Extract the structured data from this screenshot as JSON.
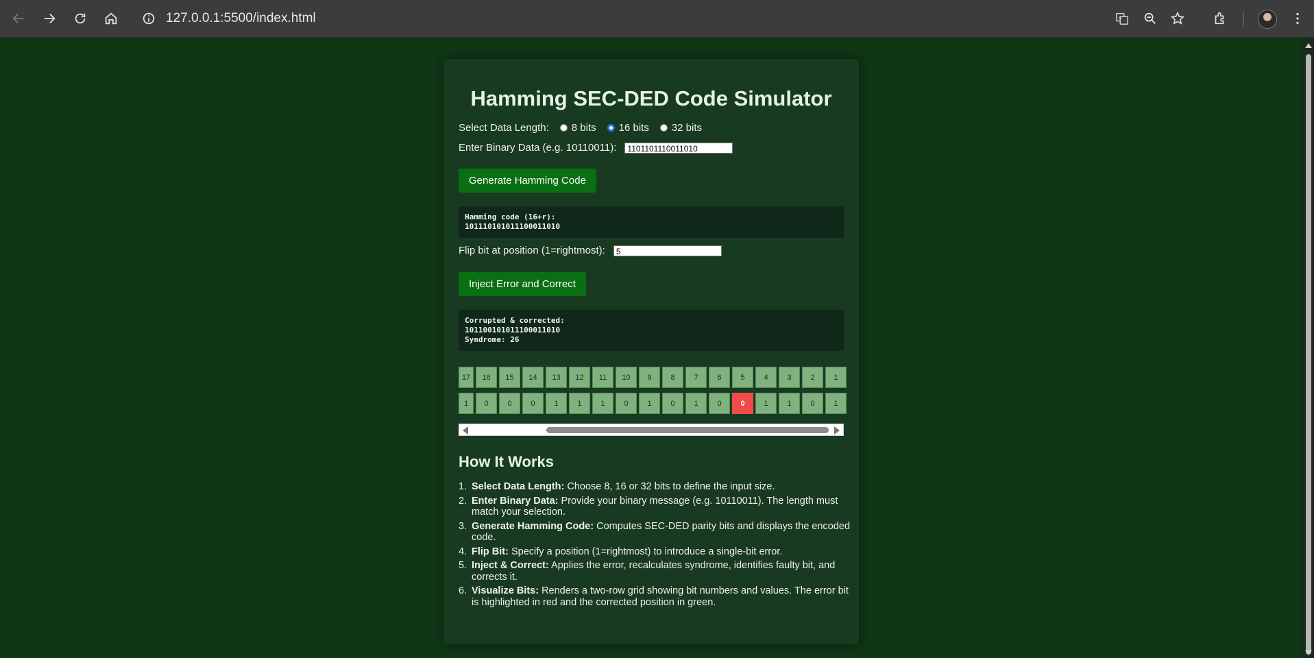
{
  "browser": {
    "url": "127.0.0.1:5500/index.html"
  },
  "page": {
    "title": "Hamming SEC-DED Code Simulator",
    "data_length": {
      "label": "Select Data Length:",
      "options": [
        "8 bits",
        "16 bits",
        "32 bits"
      ],
      "selected": "16 bits"
    },
    "binary_input": {
      "label": "Enter Binary Data (e.g. 10110011):",
      "value": "1101101110011010"
    },
    "generate_button": "Generate Hamming Code",
    "hamming_output": {
      "line1": "Hamming code (16+r):",
      "line2": "10111010101110001101​0"
    },
    "flip_input": {
      "label": "Flip bit at position (1=rightmost):",
      "value": "5"
    },
    "inject_button": "Inject Error and Correct",
    "corrected_output": {
      "line1": "Corrupted & corrected:",
      "line2": "10110010101110001101​0",
      "line3": "Syndrome: 26"
    },
    "bit_grid": {
      "positions": [
        "17",
        "16",
        "15",
        "14",
        "13",
        "12",
        "11",
        "10",
        "9",
        "8",
        "7",
        "6",
        "5",
        "4",
        "3",
        "2",
        "1"
      ],
      "values": [
        "1",
        "0",
        "0",
        "0",
        "1",
        "1",
        "1",
        "0",
        "1",
        "0",
        "1",
        "0",
        "0",
        "1",
        "1",
        "0",
        "1"
      ],
      "error_position": "5",
      "error_color": "#f24a4a",
      "cell_color": "#7fb27f"
    },
    "how_it_works": {
      "heading": "How It Works",
      "steps": [
        {
          "num": "1.",
          "title": "Select Data Length:",
          "text": " Choose 8, 16 or 32 bits to define the input size."
        },
        {
          "num": "2.",
          "title": "Enter Binary Data:",
          "text": " Provide your binary message (e.g. 10110011). The length must match your selection."
        },
        {
          "num": "3.",
          "title": "Generate Hamming Code:",
          "text": " Computes SEC-DED parity bits and displays the encoded code."
        },
        {
          "num": "4.",
          "title": "Flip Bit:",
          "text": " Specify a position (1=rightmost) to introduce a single-bit error."
        },
        {
          "num": "5.",
          "title": "Inject & Correct:",
          "text": " Applies the error, recalculates syndrome, identifies faulty bit, and corrects it."
        },
        {
          "num": "6.",
          "title": "Visualize Bits:",
          "text": " Renders a two-row grid showing bit numbers and values. The error bit is highlighted in red and the corrected position in green."
        }
      ]
    }
  },
  "colors": {
    "page_bg": "#0f3615",
    "card_bg": "#183a21",
    "button_bg": "#0a6e12",
    "output_bg": "#10281a"
  }
}
